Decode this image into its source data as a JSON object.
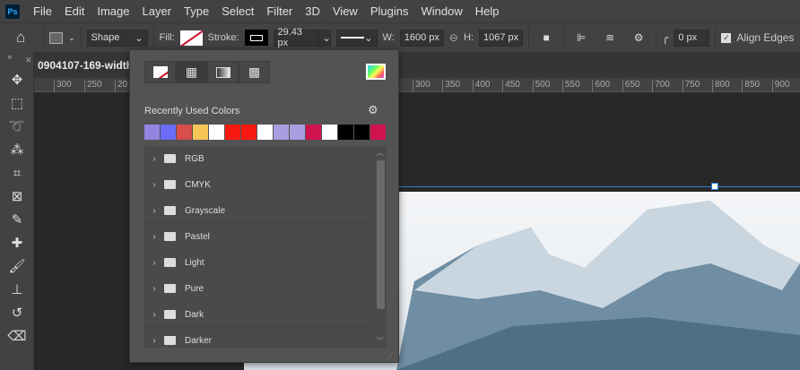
{
  "app": {
    "logo": "Ps"
  },
  "menu": [
    "File",
    "Edit",
    "Image",
    "Layer",
    "Type",
    "Select",
    "Filter",
    "3D",
    "View",
    "Plugins",
    "Window",
    "Help"
  ],
  "options": {
    "mode": "Shape",
    "fill_label": "Fill:",
    "stroke_label": "Stroke:",
    "stroke_width": "29.43 px",
    "w_label": "W:",
    "w_value": "1600 px",
    "h_label": "H:",
    "h_value": "1067 px",
    "radius": "0 px",
    "align_edges": "Align Edges"
  },
  "document": {
    "tab_title": "0904107-169-width"
  },
  "ruler": {
    "left": [
      "300",
      "250",
      "20"
    ],
    "right": [
      "300",
      "350",
      "400",
      "450",
      "500",
      "550",
      "600",
      "650",
      "700",
      "750",
      "800",
      "850",
      "900"
    ]
  },
  "popup": {
    "recent_label": "Recently Used Colors",
    "recent_colors": [
      "#9584e0",
      "#6b6cf6",
      "#d84c4c",
      "#f6c656",
      "#ffffff",
      "#f81a12",
      "#f81a12",
      "#ffffff",
      "#a89ee0",
      "#a89ee0",
      "#d0134f",
      "#ffffff",
      "#000000",
      "#000000",
      "#d0134f"
    ],
    "groups": [
      "RGB",
      "CMYK",
      "Grayscale",
      "Pastel",
      "Light",
      "Pure",
      "Dark",
      "Darker"
    ]
  }
}
